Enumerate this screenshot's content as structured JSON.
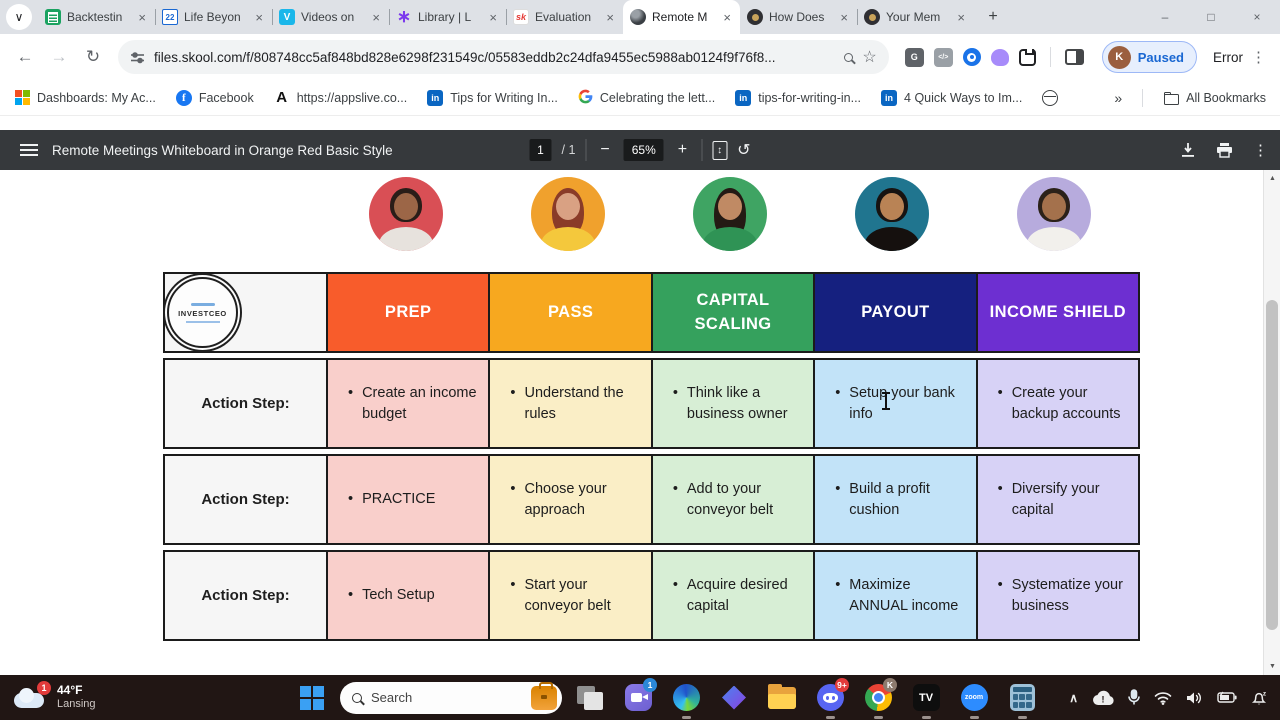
{
  "icons": {
    "tab_search": "∨",
    "tab_close": "×",
    "minimize": "–",
    "maximize": "□",
    "close": "×",
    "back": "←",
    "forward": "→",
    "reload": "↻",
    "star": "☆",
    "g_box": "G",
    "code_box": "</>",
    "kebab": "⋮",
    "new_tab": "+",
    "zoom_out": "−",
    "zoom_in": "+",
    "fit_arrow": "↕",
    "rotate": "↺",
    "overflow": "»",
    "scroll_up": "▲",
    "scroll_down": "▼",
    "chevron_up": "∧",
    "flower": "∗"
  },
  "browser": {
    "tabs": [
      {
        "label": "Backtestin"
      },
      {
        "label": "Life Beyon"
      },
      {
        "label": "Videos on"
      },
      {
        "label": "Library | L"
      },
      {
        "label": "Evaluation"
      },
      {
        "label": "Remote M"
      },
      {
        "label": "How Does"
      },
      {
        "label": "Your Mem"
      }
    ],
    "icon_text": {
      "calendar": "22",
      "vimeo": "V",
      "skool": "sk",
      "facebook": "f",
      "linkedin": "in"
    },
    "url": "files.skool.com/f/808748cc5af848bd828e6298f231549c/05583eddb2c24dfa9455ec5988ab0124f9f76f8...",
    "profile_chip": {
      "initial": "K",
      "label": "Paused"
    },
    "error_label": "Error",
    "bookmarks": [
      {
        "label": "Dashboards: My Ac..."
      },
      {
        "label": "Facebook"
      },
      {
        "label": "https://appslive.co..."
      },
      {
        "label": "Tips for Writing In..."
      },
      {
        "label": "Celebrating the lett..."
      },
      {
        "label": "tips-for-writing-in..."
      },
      {
        "label": "4 Quick Ways to Im..."
      }
    ],
    "all_bookmarks_label": "All Bookmarks"
  },
  "pdf_viewer": {
    "title": "Remote Meetings Whiteboard in Orange Red Basic Style",
    "page_number": "1",
    "page_total": "/ 1",
    "zoom_value": "65%"
  },
  "whiteboard": {
    "logo_text": "INVESTCEO",
    "bullet": "•",
    "row_label": "Action Step:",
    "avatar_colors": [
      "#d94f55",
      "#f0a12d",
      "#3fa463",
      "#20758f",
      "#b7abdd"
    ],
    "columns": [
      {
        "header": "PREP",
        "header_bg": "#f85c2b",
        "cell_bg": "#f9cfcb"
      },
      {
        "header": "PASS",
        "header_bg": "#f7a81f",
        "cell_bg": "#faeec6"
      },
      {
        "header": "CAPITAL SCALING",
        "header_bg": "#35a15d",
        "cell_bg": "#d7eed5"
      },
      {
        "header": "PAYOUT",
        "header_bg": "#15207f",
        "cell_bg": "#c2e3f8"
      },
      {
        "header": "INCOME SHIELD",
        "header_bg": "#6d2fd1",
        "cell_bg": "#d7d2f6"
      }
    ],
    "rows": [
      [
        "Create an income budget",
        "Understand the rules",
        "Think like a business owner",
        "Setup your bank info",
        "Create your backup accounts"
      ],
      [
        "PRACTICE",
        "Choose your approach",
        "Add to your conveyor belt",
        "Build a profit cushion",
        "Diversify your capital"
      ],
      [
        "Tech Setup",
        "Start your conveyor belt",
        "Acquire desired capital",
        "Maximize ANNUAL income",
        "Systematize your business"
      ]
    ]
  },
  "taskbar": {
    "weather": {
      "badge": "1",
      "temperature": "44°F",
      "location": "Lansing"
    },
    "search_label": "Search",
    "badges": {
      "teams": "1",
      "discord": "9+",
      "chrome": "K"
    },
    "labels": {
      "tradingview": "TV",
      "zoom": "zoom"
    }
  }
}
